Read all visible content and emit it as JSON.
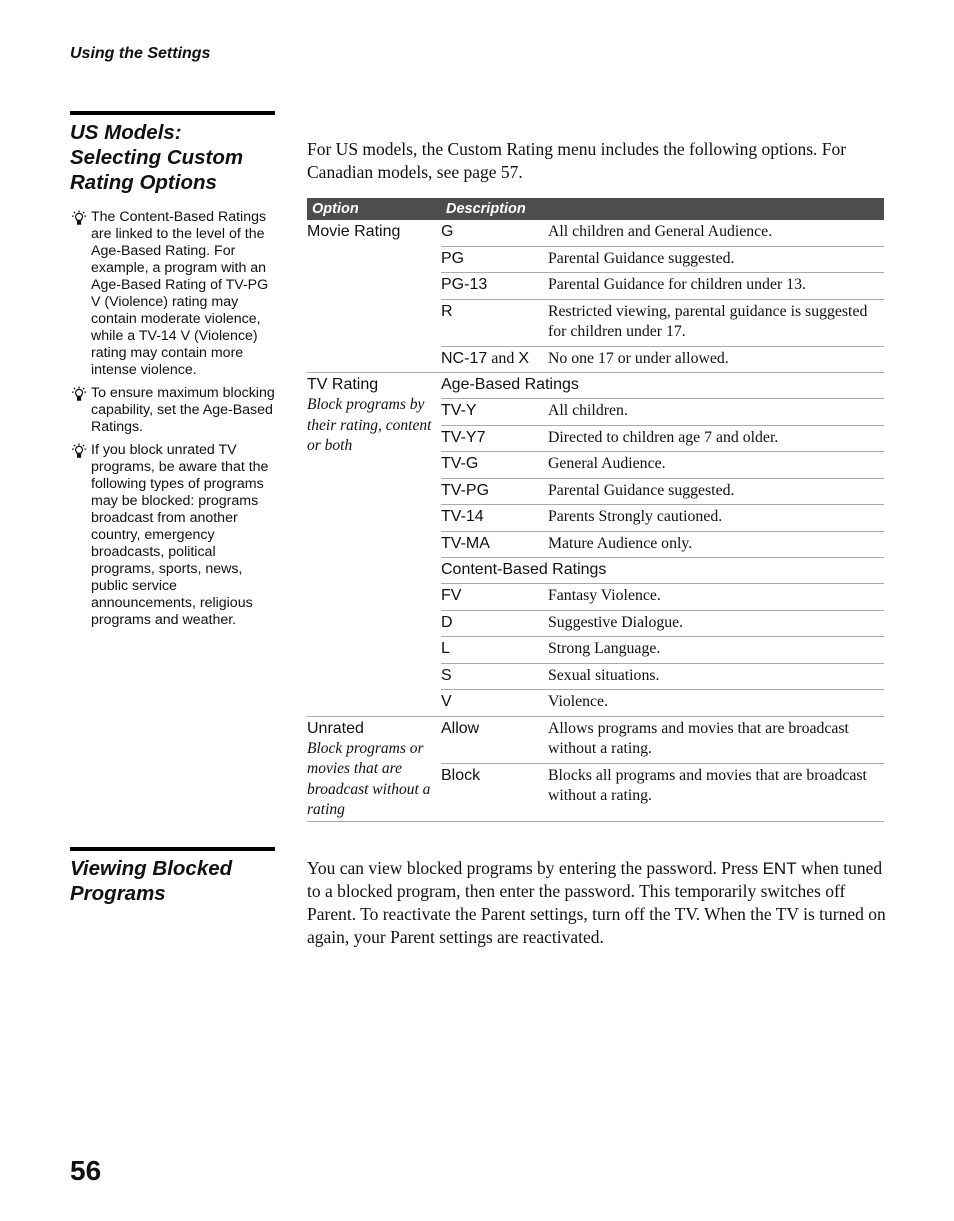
{
  "running_head": "Using the Settings",
  "section1": {
    "title_lines": [
      "US Models:",
      "Selecting Custom",
      "Rating Options"
    ],
    "intro": "For US models, the Custom Rating menu includes the following options. For Canadian models, see page 57.",
    "tips": [
      {
        "icon": "lightbulb-icon",
        "text": "The Content-Based Ratings are linked to the level of the Age-Based Rating. For example, a program with an Age-Based Rating of TV-PG V (Violence) rating may contain moderate violence, while a TV-14 V (Violence) rating may contain more intense violence."
      },
      {
        "icon": "lightbulb-icon",
        "text": "To ensure maximum blocking capability, set the Age-Based Ratings."
      },
      {
        "icon": "lightbulb-icon",
        "text": "If you block unrated TV programs, be aware that the following types of programs may be blocked: programs broadcast from another country, emergency broadcasts, political programs, sports, news, public service announcements, religious programs and weather."
      }
    ],
    "table": {
      "header": {
        "option": "Option",
        "description": "Description"
      },
      "header_color": "#4d4d4d",
      "groups": [
        {
          "name": "Movie Rating",
          "note": "",
          "rows": [
            {
              "code": "G",
              "desc": "All children and General Audience."
            },
            {
              "code": "PG",
              "desc": "Parental Guidance suggested."
            },
            {
              "code": "PG-13",
              "desc": "Parental Guidance for children under 13."
            },
            {
              "code": "R",
              "desc": "Restricted viewing, parental guidance is suggested for children under 17."
            },
            {
              "code": "NC-17",
              "code_and": " and ",
              "code_extra": "X",
              "desc": "No one 17 or under allowed."
            }
          ]
        },
        {
          "name": "TV Rating",
          "note": "Block programs by their rating, content or both",
          "rows": [
            {
              "subhead": "Age-Based Ratings"
            },
            {
              "code": "TV-Y",
              "desc": "All children."
            },
            {
              "code": "TV-Y7",
              "desc": "Directed to children age 7 and older."
            },
            {
              "code": "TV-G",
              "desc": "General Audience."
            },
            {
              "code": "TV-PG",
              "desc": "Parental Guidance suggested."
            },
            {
              "code": "TV-14",
              "desc": "Parents Strongly cautioned."
            },
            {
              "code": "TV-MA",
              "desc": "Mature Audience only."
            },
            {
              "subhead": "Content-Based Ratings"
            },
            {
              "code": "FV",
              "desc": "Fantasy Violence."
            },
            {
              "code": "D",
              "desc": "Suggestive Dialogue."
            },
            {
              "code": "L",
              "desc": "Strong Language."
            },
            {
              "code": "S",
              "desc": "Sexual situations."
            },
            {
              "code": "V",
              "desc": "Violence."
            }
          ]
        },
        {
          "name": "Unrated",
          "note": "Block programs or movies that are broadcast without a rating",
          "rows": [
            {
              "code": "Allow",
              "desc": "Allows programs and movies that are broadcast without a rating."
            },
            {
              "code": "Block",
              "desc": "Blocks all programs and movies that are broadcast without a rating."
            }
          ]
        }
      ]
    }
  },
  "section2": {
    "title_lines": [
      "Viewing Blocked",
      "Programs"
    ],
    "text_before": "You can view blocked programs by entering the password. Press ",
    "button_name": "ENT",
    "text_after": " when tuned to a blocked program, then enter the password. This temporarily switches off Parent. To reactivate the Parent settings, turn off the TV. When the TV is turned on again, your Parent settings are reactivated."
  },
  "page_number": "56"
}
